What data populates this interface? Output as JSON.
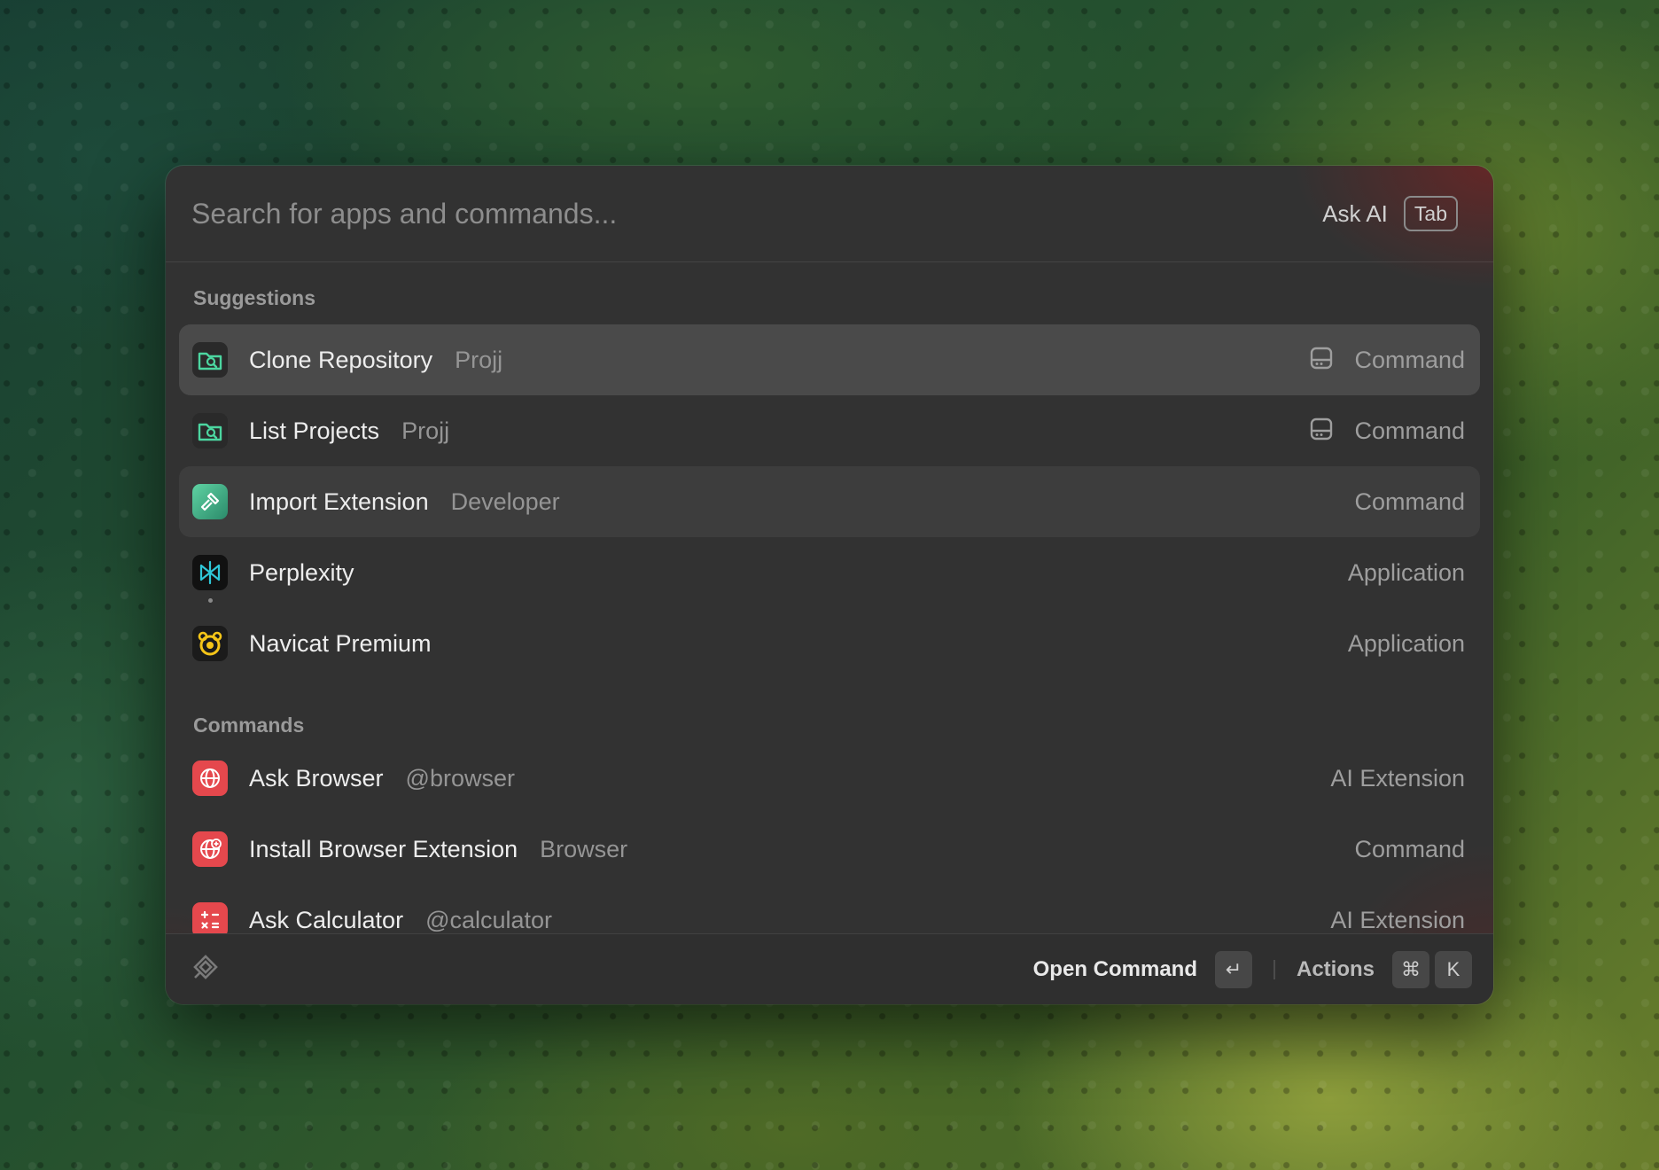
{
  "search": {
    "placeholder": "Search for apps and commands...",
    "ask_ai_label": "Ask AI",
    "ask_ai_shortcut": "Tab"
  },
  "sections": {
    "suggestions": {
      "title": "Suggestions",
      "items": [
        {
          "title": "Clone Repository",
          "subtitle": "Projj",
          "type": "Command",
          "icon": "folder-sync-icon",
          "accessory_icon": "drive-icon",
          "state": "selected"
        },
        {
          "title": "List Projects",
          "subtitle": "Projj",
          "type": "Command",
          "icon": "folder-sync-icon",
          "accessory_icon": "drive-icon"
        },
        {
          "title": "Import Extension",
          "subtitle": "Developer",
          "type": "Command",
          "icon": "hammer-icon",
          "state": "hover"
        },
        {
          "title": "Perplexity",
          "subtitle": "",
          "type": "Application",
          "icon": "perplexity-icon",
          "running": true
        },
        {
          "title": "Navicat Premium",
          "subtitle": "",
          "type": "Application",
          "icon": "navicat-icon"
        }
      ]
    },
    "commands": {
      "title": "Commands",
      "items": [
        {
          "title": "Ask Browser",
          "subtitle": "@browser",
          "type": "AI Extension",
          "icon": "globe-icon"
        },
        {
          "title": "Install Browser Extension",
          "subtitle": "Browser",
          "type": "Command",
          "icon": "globe-plus-icon"
        },
        {
          "title": "Ask Calculator",
          "subtitle": "@calculator",
          "type": "AI Extension",
          "icon": "calculator-icon"
        }
      ]
    }
  },
  "footer": {
    "primary_action": "Open Command",
    "primary_shortcut": "↵",
    "actions_label": "Actions",
    "actions_shortcut": [
      "⌘",
      "K"
    ],
    "logo_icon": "raycast-logo-icon"
  },
  "colors": {
    "window_bg": "#323232",
    "selected_row": "#4a4a4a",
    "accent_red": "#e5484d",
    "accent_green": "#3fbf8a"
  }
}
